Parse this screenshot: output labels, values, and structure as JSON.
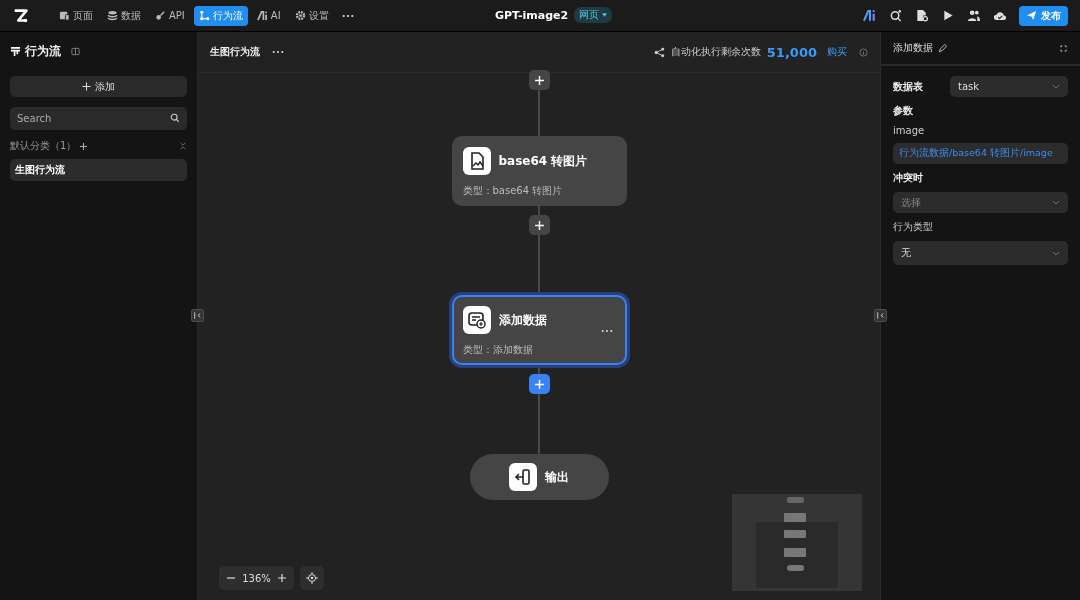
{
  "topbar": {
    "nav": [
      {
        "label": "页面",
        "selected": false
      },
      {
        "label": "数据",
        "selected": false
      },
      {
        "label": "API",
        "selected": false
      },
      {
        "label": "行为流",
        "selected": true
      },
      {
        "label": "AI",
        "selected": false
      },
      {
        "label": "设置",
        "selected": false
      }
    ],
    "title": "GPT-image2",
    "badge": "网页",
    "publish": "发布"
  },
  "sidebar": {
    "title": "行为流",
    "add_button": "添加",
    "search": {
      "placeholder": "Search"
    },
    "group": "默认分类（1）",
    "items": [
      {
        "label": "生图行为流",
        "selected": true
      }
    ]
  },
  "canvas": {
    "title": "生图行为流",
    "quota_label": "自动化执行剩余次数",
    "quota_value": "51,000",
    "buy": "购买",
    "nodes": [
      {
        "kind": "step",
        "title": "base64 转图片",
        "subtitle": "类型：base64 转图片",
        "selected": false
      },
      {
        "kind": "step",
        "title": "添加数据",
        "subtitle": "类型：添加数据",
        "selected": true
      },
      {
        "kind": "end",
        "title": "输出"
      }
    ],
    "zoom": "136%"
  },
  "panel": {
    "title": "添加数据",
    "table": {
      "label": "数据表",
      "value": "task"
    },
    "section": "参数",
    "param": {
      "label": "image",
      "value": "行为流数据/base64 转图片/image"
    },
    "conflict": {
      "label": "冲突时",
      "placeholder": "选择"
    },
    "action_type": {
      "label": "行为类型",
      "value": "无"
    }
  }
}
